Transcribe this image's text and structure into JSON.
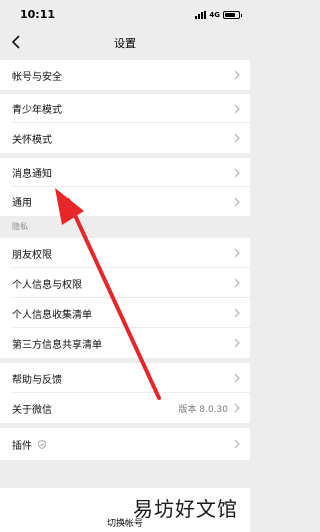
{
  "status_bar": {
    "time": "10:11",
    "network": "4G"
  },
  "header": {
    "title": "设置"
  },
  "sections": {
    "account": {
      "label": "帐号与安全"
    },
    "teen_mode": {
      "label": "青少年模式"
    },
    "care_mode": {
      "label": "关怀模式"
    },
    "notifications": {
      "label": "消息通知"
    },
    "general": {
      "label": "通用"
    },
    "privacy_header": "隐私",
    "friend_permissions": {
      "label": "朋友权限"
    },
    "personal_info": {
      "label": "个人信息与权限"
    },
    "personal_info_list": {
      "label": "个人信息收集清单"
    },
    "third_party_list": {
      "label": "第三方信息共享清单"
    },
    "help": {
      "label": "帮助与反馈"
    },
    "about": {
      "label": "关于微信",
      "value": "版本 8.0.30"
    },
    "plugins": {
      "label": "插件"
    }
  },
  "bottom": {
    "switch_account": "切换帐号"
  },
  "watermark": "易坊好文馆",
  "colors": {
    "arrow": "#e8262a",
    "background": "#ededed",
    "row": "#ffffff"
  },
  "icons": [
    "back-icon",
    "chevron-right-icon",
    "shield-icon",
    "signal-icon",
    "battery-icon"
  ]
}
